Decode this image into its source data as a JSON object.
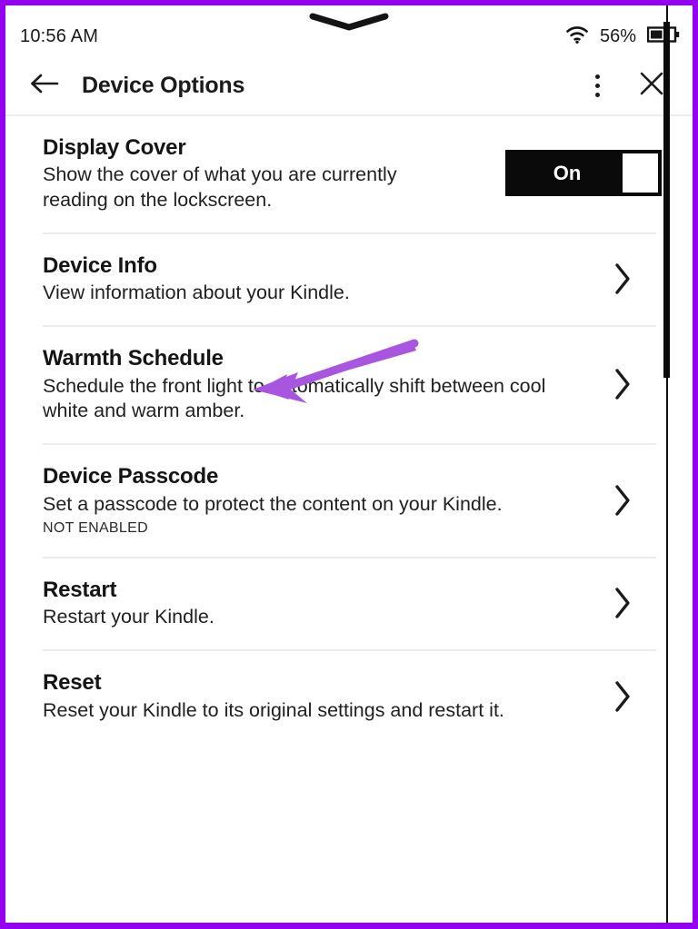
{
  "theme": {
    "device_border": "#9400f0",
    "annotation_arrow": "#a855e0",
    "toggle_on_bg": "#0a0a0a",
    "text": "#151515",
    "divider": "#ebebeb"
  },
  "status_bar": {
    "time": "10:56 AM",
    "battery_percent": "56%",
    "wifi_icon": "wifi-icon",
    "battery_icon": "battery-half-icon",
    "drag_handle_icon": "chevron-down-handle-icon"
  },
  "header": {
    "title": "Device Options",
    "back_icon": "arrow-left-icon",
    "menu_icon": "more-vertical-icon",
    "close_icon": "close-icon"
  },
  "settings": {
    "rows": [
      {
        "title": "Display Cover",
        "description": "Show the cover of what you are currently reading on the lockscreen.",
        "accessory": "toggle",
        "toggle_value": "On"
      },
      {
        "title": "Device Info",
        "description": "View information about your Kindle.",
        "accessory": "chevron"
      },
      {
        "title": "Warmth Schedule",
        "description": "Schedule the front light to automatically shift between cool white and warm amber.",
        "accessory": "chevron"
      },
      {
        "title": "Device Passcode",
        "description": "Set a passcode to protect the content on your Kindle.",
        "status": "NOT ENABLED",
        "accessory": "chevron"
      },
      {
        "title": "Restart",
        "description": "Restart your Kindle.",
        "accessory": "chevron"
      },
      {
        "title": "Reset",
        "description": "Reset your Kindle to its original settings and restart it.",
        "accessory": "chevron"
      }
    ]
  },
  "annotation": {
    "icon": "arrow-pointer-icon",
    "points_to": "Warmth Schedule"
  },
  "scrollbar": {
    "icon": "scrollbar-vertical"
  }
}
